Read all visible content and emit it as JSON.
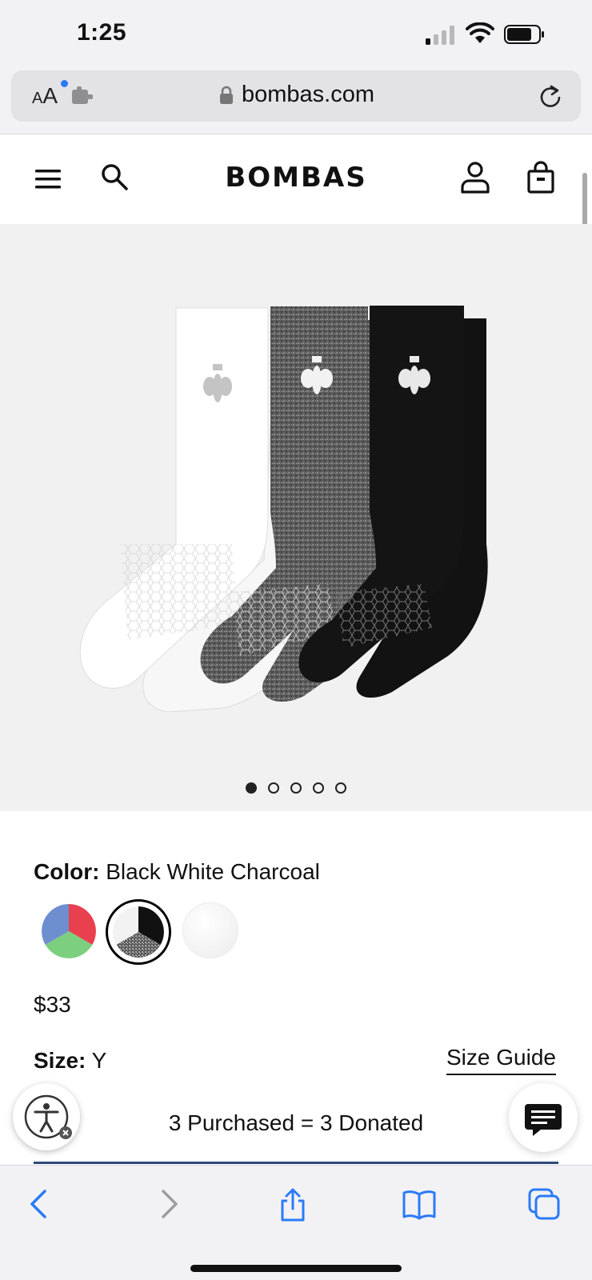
{
  "status_bar": {
    "time": "1:25"
  },
  "browser": {
    "url": "bombas.com",
    "text_size_label": "AA"
  },
  "site": {
    "logo": "BOMBAS"
  },
  "gallery": {
    "image_count": 5,
    "active_index": 0
  },
  "product": {
    "color_label": "Color:",
    "color_value": "Black White Charcoal",
    "price": "$33",
    "size_label": "Size:",
    "size_value": "Y",
    "size_guide": "Size Guide",
    "donation_text": "3 Purchased = 3 Donated",
    "swatches": [
      {
        "name": "multicolor",
        "colors": [
          "#e9404f",
          "#6d8fd0",
          "#7ccf7e"
        ]
      },
      {
        "name": "black-white-charcoal",
        "colors": [
          "#111111",
          "#f2f2f2",
          "#6f6f6f"
        ],
        "selected": true
      },
      {
        "name": "white",
        "colors": [
          "#ffffff"
        ]
      }
    ]
  },
  "colors": {
    "accent_blue": "#2b7bf7",
    "toolbar_bg": "#f2f2f4"
  },
  "icons": [
    "menu-icon",
    "search-icon",
    "account-icon",
    "cart-icon",
    "lock-icon",
    "reload-icon",
    "accessibility-icon",
    "chat-icon",
    "back-icon",
    "forward-icon",
    "share-icon",
    "bookmarks-icon",
    "tabs-icon"
  ]
}
